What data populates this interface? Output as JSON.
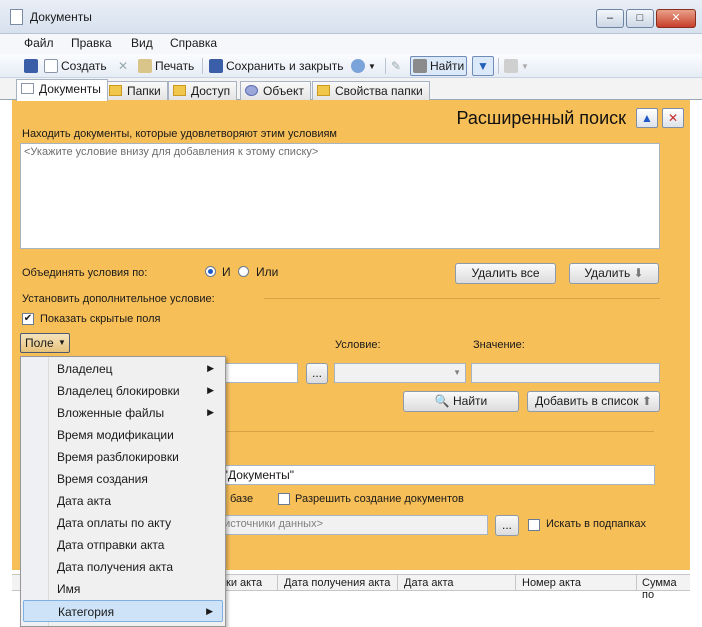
{
  "window": {
    "title": "Документы",
    "btn_min": "–",
    "btn_max": "□",
    "btn_close": "✕"
  },
  "menu": [
    "Файл",
    "Правка",
    "Вид",
    "Справка"
  ],
  "toolbar": {
    "create": "Создать",
    "print": "Печать",
    "save_close": "Сохранить и закрыть",
    "find": "Найти"
  },
  "tabs": [
    "Документы",
    "Папки",
    "Доступ",
    "Объект",
    "Свойства папки"
  ],
  "search": {
    "heading": "Расширенный поиск",
    "find_docs_label": "Находить документы, которые удовлетворяют этим условиям",
    "conditions_placeholder": "<Укажите условие внизу для добавления к этому списку>",
    "combine_label": "Объединять условия по:",
    "radio_and": "И",
    "radio_or": "Или",
    "delete_all": "Удалить все",
    "delete": "Удалить",
    "additional_label": "Установить дополнительное условие:",
    "show_hidden": "Показать скрытые поля",
    "field_dropdown": "Поле",
    "condition_label": "Условие:",
    "value_label": "Значение:",
    "browse": "...",
    "find_btn": "Найти",
    "add_to_list": "Добавить в список"
  },
  "folder": {
    "folder_value": "ра \"Документы\"",
    "in_base": "базе",
    "allow_create": "Разрешить создание документов",
    "sources_placeholder": "ые источники данных>",
    "search_subfolders": "Искать в подпапках"
  },
  "field_menu": [
    {
      "label": "Владелец",
      "sub": true
    },
    {
      "label": "Владелец блокировки",
      "sub": true
    },
    {
      "label": "Вложенные файлы",
      "sub": true
    },
    {
      "label": "Время модификации",
      "sub": false
    },
    {
      "label": "Время разблокировки",
      "sub": false
    },
    {
      "label": "Время создания",
      "sub": false
    },
    {
      "label": "Дата акта",
      "sub": false
    },
    {
      "label": "Дата оплаты по акту",
      "sub": false
    },
    {
      "label": "Дата отправки акта",
      "sub": false
    },
    {
      "label": "Дата получения акта",
      "sub": false
    },
    {
      "label": "Имя",
      "sub": false
    },
    {
      "label": "Категория",
      "sub": true
    }
  ],
  "grid_columns": [
    "ки акта",
    "Дата получения акта",
    "Дата акта",
    "Номер акта",
    "Сумма по"
  ],
  "colors": {
    "panel": "#f7bf58",
    "highlight": "#cfe3f8",
    "accent": "#1f58c7"
  }
}
